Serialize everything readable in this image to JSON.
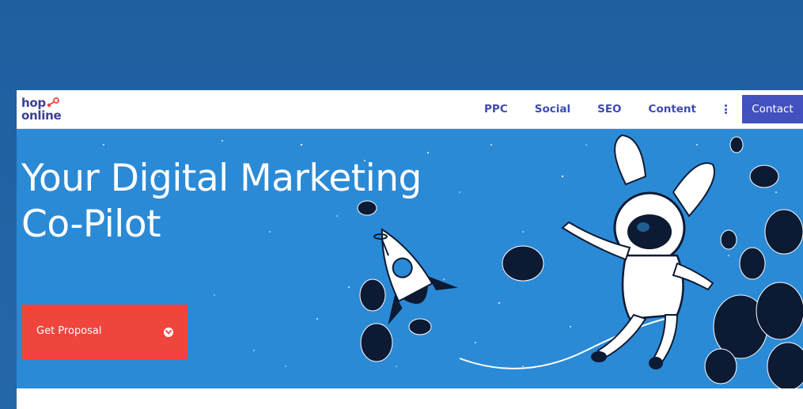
{
  "brand": {
    "logo_line1": "hop",
    "logo_line2": "online",
    "accent_color": "#f0453c",
    "primary_color": "#3d4bb0"
  },
  "nav": {
    "items": [
      {
        "label": "PPC"
      },
      {
        "label": "Social"
      },
      {
        "label": "SEO"
      },
      {
        "label": "Content"
      }
    ],
    "more_icon": "vertical-ellipsis-icon",
    "contact_label": "Contact"
  },
  "hero": {
    "title_line1": "Your Digital Marketing",
    "title_line2": "Co-Pilot",
    "cta_label": "Get Proposal",
    "cta_icon": "chevron-down-circle-icon",
    "background_color": "#2b8ad6",
    "illustration": "astronaut-bunny-in-space-with-rocket"
  }
}
